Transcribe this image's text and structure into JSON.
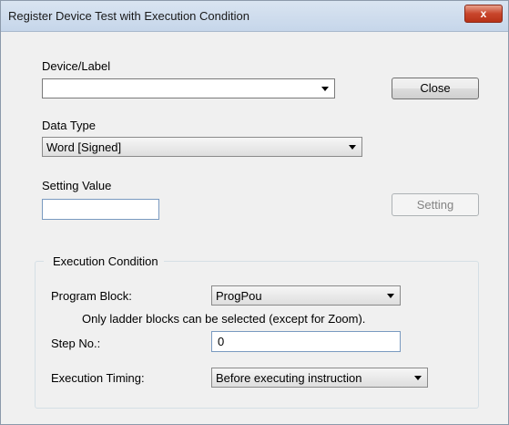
{
  "window": {
    "title": "Register Device Test with Execution Condition",
    "close_glyph": "x"
  },
  "device_label": {
    "label": "Device/Label",
    "value": ""
  },
  "close_button": {
    "label": "Close"
  },
  "data_type": {
    "label": "Data Type",
    "value": "Word [Signed]"
  },
  "setting_value": {
    "label": "Setting Value",
    "value": ""
  },
  "setting_button": {
    "label": "Setting"
  },
  "execution_condition": {
    "title": "Execution Condition",
    "program_block": {
      "label": "Program Block:",
      "value": "ProgPou"
    },
    "note": "Only ladder blocks can be selected (except for Zoom).",
    "step_no": {
      "label": "Step No.:",
      "value": "0"
    },
    "execution_timing": {
      "label": "Execution Timing:",
      "value": "Before executing instruction"
    }
  }
}
